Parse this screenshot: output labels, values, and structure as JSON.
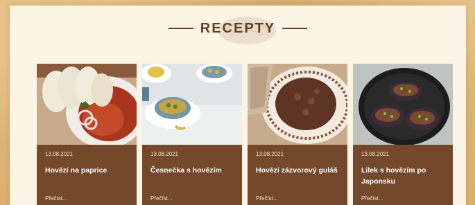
{
  "section": {
    "heading": "RECEPTY"
  },
  "recipes": [
    {
      "date": "13.08.2021",
      "title": "Hovězí na paprice",
      "more": "Přečíst...",
      "image": "beef-paprika-dumplings-photo"
    },
    {
      "date": "13.08.2021",
      "title": "Česnečka s hovězím",
      "more": "Přečíst...",
      "image": "garlic-soup-bowls-photo"
    },
    {
      "date": "13.08.2021",
      "title": "Hovězí zázvorový guláš",
      "more": "Přečíst...",
      "image": "ginger-goulash-bowl-photo"
    },
    {
      "date": "13.08.2021",
      "title": "Lilek s hovězím po Japonsku",
      "more": "Přečíst...",
      "image": "stuffed-eggplant-pan-photo"
    }
  ],
  "colors": {
    "card": "#74482a",
    "heading": "#6a3d1e",
    "panel": "#fcf5e6"
  }
}
